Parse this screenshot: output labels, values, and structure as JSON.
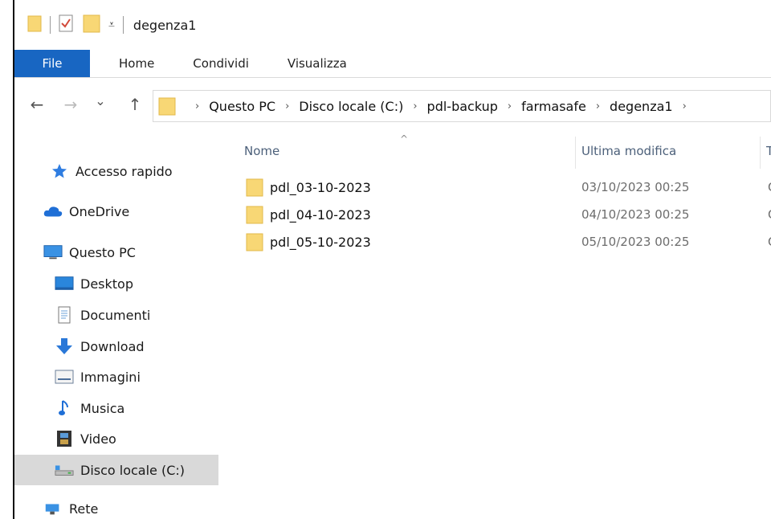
{
  "window": {
    "title": "degenza1"
  },
  "ribbon": {
    "tabs": [
      "File",
      "Home",
      "Condividi",
      "Visualizza"
    ]
  },
  "nav": {
    "back": "←",
    "forward": "→",
    "recent": "⌄",
    "up": "↑"
  },
  "address": {
    "crumbs": [
      "Questo PC",
      "Disco locale (C:)",
      "pdl-backup",
      "farmasafe",
      "degenza1"
    ]
  },
  "sidebar": {
    "items": [
      {
        "label": "Accesso rapido",
        "icon": "star-icon"
      },
      {
        "label": "OneDrive",
        "icon": "cloud-icon"
      },
      {
        "label": "Questo PC",
        "icon": "monitor-icon"
      },
      {
        "label": "Desktop",
        "icon": "desktop-icon"
      },
      {
        "label": "Documenti",
        "icon": "document-icon"
      },
      {
        "label": "Download",
        "icon": "download-arrow-icon"
      },
      {
        "label": "Immagini",
        "icon": "image-icon"
      },
      {
        "label": "Musica",
        "icon": "music-note-icon"
      },
      {
        "label": "Video",
        "icon": "film-icon"
      },
      {
        "label": "Disco locale (C:)",
        "icon": "drive-icon",
        "selected": true
      },
      {
        "label": "Rete",
        "icon": "network-icon"
      }
    ]
  },
  "list": {
    "columns": {
      "name": "Nome",
      "modified": "Ultima modifica",
      "next": "T"
    },
    "rows": [
      {
        "name": "pdl_03-10-2023",
        "date": "03/10/2023 00:25",
        "clip": "C"
      },
      {
        "name": "pdl_04-10-2023",
        "date": "04/10/2023 00:25",
        "clip": "C"
      },
      {
        "name": "pdl_05-10-2023",
        "date": "05/10/2023 00:25",
        "clip": "C"
      }
    ]
  },
  "colors": {
    "file_tab": "#1866c2",
    "folder": "#f8d775",
    "selected": "#d9d9d9",
    "header_text": "#4c607a"
  }
}
